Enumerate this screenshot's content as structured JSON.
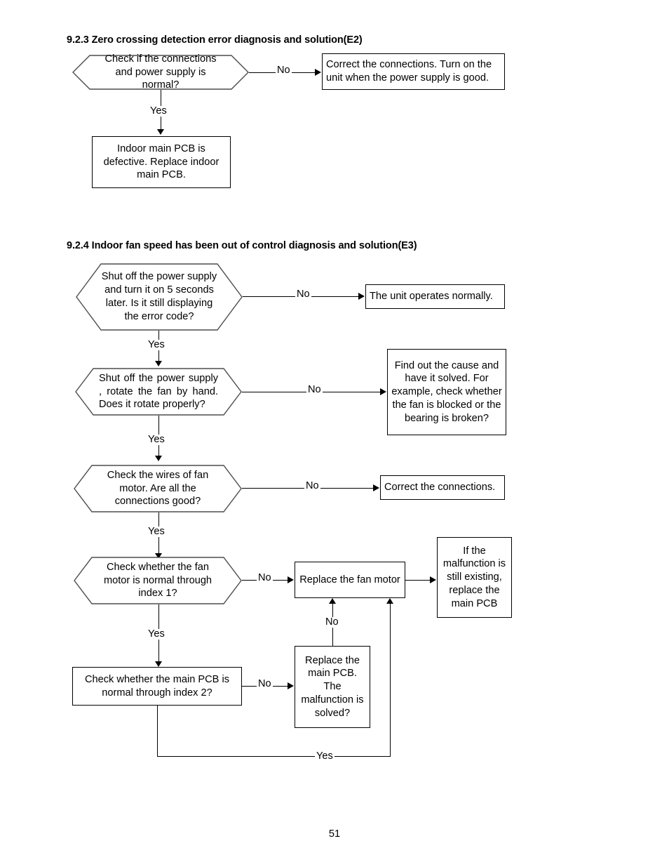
{
  "document": {
    "page_number": "51"
  },
  "sections": [
    {
      "heading": "9.2.3 Zero crossing detection error diagnosis and solution(E2)",
      "nodes": {
        "decision_1": "Check if the connections and power supply is normal?",
        "action_no_1": "Correct the connections. Turn on the unit when the power supply is good.",
        "action_yes_1": "Indoor main PCB is defective. Replace indoor main PCB."
      },
      "edges": {
        "no_1": "No",
        "yes_1": "Yes"
      }
    },
    {
      "heading": "9.2.4 Indoor fan speed has been out of control diagnosis and solution(E3)",
      "nodes": {
        "decision_1": "Shut off the power supply and turn it on 5 seconds later. Is it still displaying the error code?",
        "result_1": "The unit operates normally.",
        "decision_2": "Shut off the power supply , rotate the fan by hand. Does it rotate properly?",
        "result_2": "Find out the cause and have it solved. For example, check whether the fan is blocked or the bearing is broken?",
        "decision_3": "Check the wires of fan motor. Are all the connections good?",
        "result_3": "Correct the connections.",
        "decision_4": "Check whether the fan motor is  normal through index 1?",
        "action_replace_fan": "Replace the fan motor",
        "result_final": "If the malfunction is still existing, replace the main PCB",
        "decision_5": "Check whether the main PCB is normal through index 2?",
        "action_replace_pcb": "Replace the main  PCB. The malfunction is solved?"
      },
      "edges": {
        "no_1": "No",
        "yes_1": "Yes",
        "no_2": "No",
        "yes_2": "Yes",
        "no_3": "No",
        "yes_3": "Yes",
        "no_4": "No",
        "yes_4": "Yes",
        "no_5": "No",
        "no_6": "No",
        "yes_5": "Yes"
      }
    }
  ]
}
